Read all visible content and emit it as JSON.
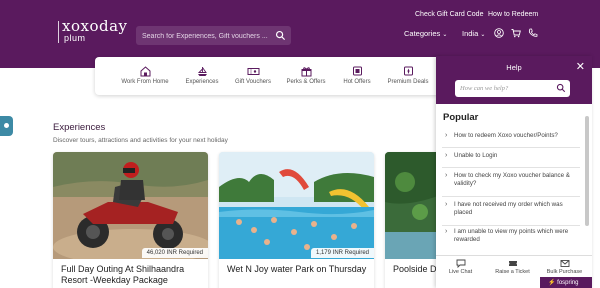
{
  "header": {
    "logo": "xoxoday",
    "logo_sub": "plum",
    "search_placeholder": "Search for Experiences, Gift vouchers ...",
    "top_links": [
      "Check Gift Card Code",
      "How to Redeem"
    ],
    "categories_label": "Categories",
    "country_label": "India"
  },
  "categories": [
    {
      "label": "Work From Home",
      "icon": "home-icon"
    },
    {
      "label": "Experiences",
      "icon": "boat-icon"
    },
    {
      "label": "Gift Vouchers",
      "icon": "voucher-icon"
    },
    {
      "label": "Perks & Offers",
      "icon": "gift-icon"
    },
    {
      "label": "Hot Offers",
      "icon": "tag-icon"
    },
    {
      "label": "Premium Deals",
      "icon": "premium-icon"
    }
  ],
  "section": {
    "title": "Experiences",
    "subtitle": "Discover tours, attractions and activities for your next holiday"
  },
  "cards": [
    {
      "price": "46,020 INR Required",
      "title": "Full Day Outing At Shilhaandra Resort -Weekday Package"
    },
    {
      "price": "1,179 INR Required",
      "title": "Wet N Joy water Park on Thursday"
    },
    {
      "price": "",
      "title": "Poolside D"
    }
  ],
  "help": {
    "title": "Help",
    "search_placeholder": "How can we help?",
    "popular_label": "Popular",
    "faqs": [
      "How to redeem Xoxo voucher/Points?",
      "Unable to Login",
      "How to check my Xoxo voucher balance & validity?",
      "I have not received my order which was placed",
      "I am unable to view my points which were rewarded"
    ],
    "footer": {
      "live_chat": "Live Chat",
      "raise_ticket": "Raise a Ticket",
      "bulk_purchase": "Bulk Purchase",
      "brand": "fospring"
    }
  },
  "colors": {
    "brand": "#5a1a5e",
    "accent": "#3d8aa5"
  }
}
